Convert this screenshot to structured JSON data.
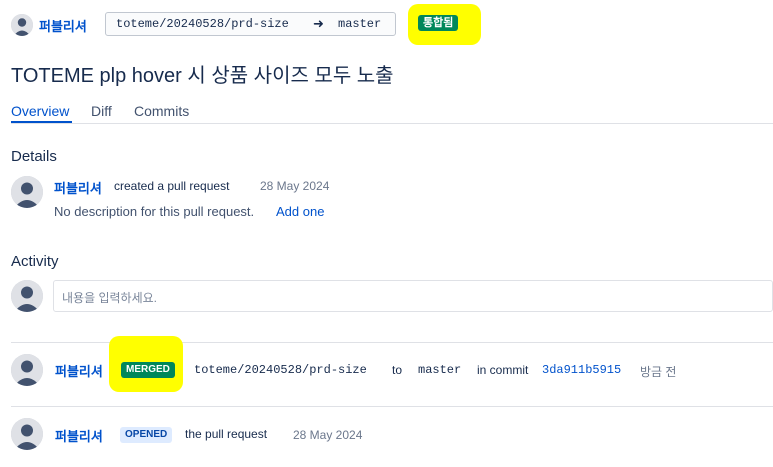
{
  "header": {
    "author": "퍼블리셔",
    "source_branch": "toteme/20240528/prd-size",
    "arrow": "➜",
    "target_branch": "master",
    "status_badge": "통합됨",
    "title": "TOTEME plp hover 시 상품 사이즈 모두 노출"
  },
  "tabs": [
    {
      "label": "Overview",
      "active": true
    },
    {
      "label": "Diff",
      "active": false
    },
    {
      "label": "Commits",
      "active": false
    }
  ],
  "details": {
    "heading": "Details",
    "author": "퍼블리셔",
    "action": "created a pull request",
    "date": "28 May 2024",
    "description": "No description for this pull request.",
    "add_link": "Add one"
  },
  "activity": {
    "heading": "Activity",
    "comment_placeholder": "내용을 입력하세요.",
    "items": [
      {
        "author": "퍼블리셔",
        "badge": "MERGED",
        "source_branch": "toteme/20240528/prd-size",
        "to": "to",
        "target_branch": "master",
        "in_commit": "in commit",
        "commit": "3da911b5915",
        "time": "방금 전"
      },
      {
        "author": "퍼블리셔",
        "badge": "OPENED",
        "action": "the pull request",
        "date": "28 May 2024"
      }
    ]
  },
  "colors": {
    "link": "#0052cc",
    "merged": "#00875a",
    "opened_bg": "#deebff",
    "opened_text": "#0747a6",
    "highlight": "#ffff00"
  }
}
